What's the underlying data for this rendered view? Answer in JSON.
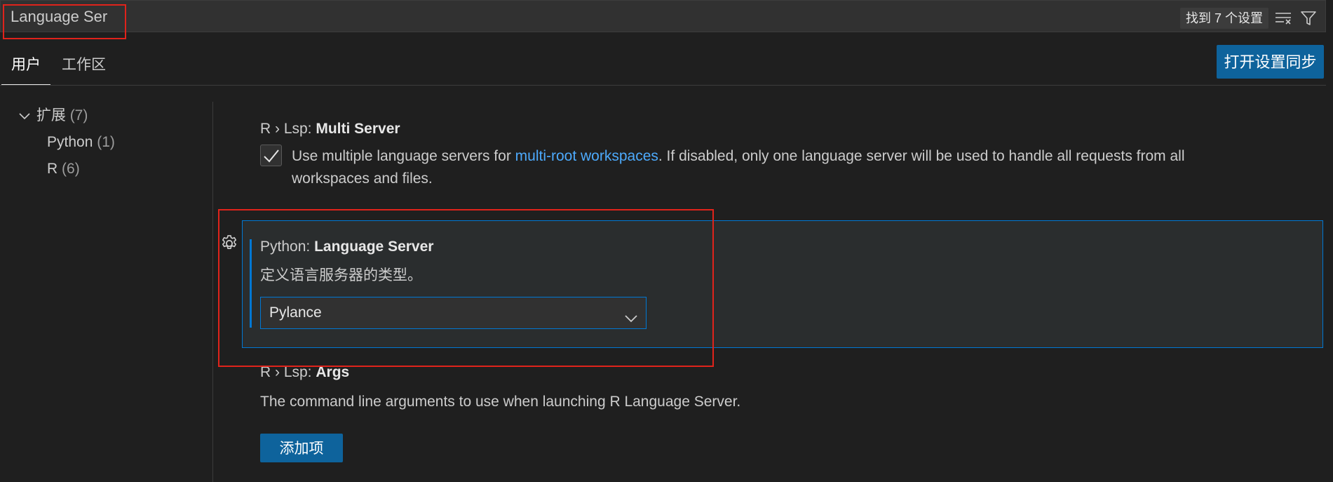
{
  "search": {
    "value": "Language Ser",
    "result_count": "找到 7 个设置",
    "clear_filter_icon": "clear-filter-icon",
    "filter_icon": "filter-icon"
  },
  "tabs": [
    {
      "label": "用户",
      "active": true
    },
    {
      "label": "工作区",
      "active": false
    }
  ],
  "sync_button": "打开设置同步",
  "tree": {
    "root": {
      "label": "扩展",
      "count": "(7)",
      "expanded": true
    },
    "children": [
      {
        "label": "Python",
        "count": "(1)"
      },
      {
        "label": "R",
        "count": "(6)"
      }
    ]
  },
  "settings": [
    {
      "prefix": "R › Lsp: ",
      "name": "Multi Server",
      "checked": true,
      "desc_before_link": "Use multiple language servers for ",
      "link": "multi-root workspaces",
      "desc_after_link": ". If disabled, only one language server will be used to handle all requests from all",
      "desc_line2": "workspaces and files."
    },
    {
      "prefix": "Python: ",
      "name": "Language Server",
      "desc": "定义语言服务器的类型。",
      "value": "Pylance"
    },
    {
      "prefix": "R › Lsp: ",
      "name": "Args",
      "desc": "The command line arguments to use when launching R Language Server.",
      "button": "添加项"
    }
  ],
  "colors": {
    "accent": "#0078d4",
    "button": "#0e639c",
    "link": "#4daafc",
    "annotation": "#e0231b",
    "background": "#1f1f1f"
  }
}
